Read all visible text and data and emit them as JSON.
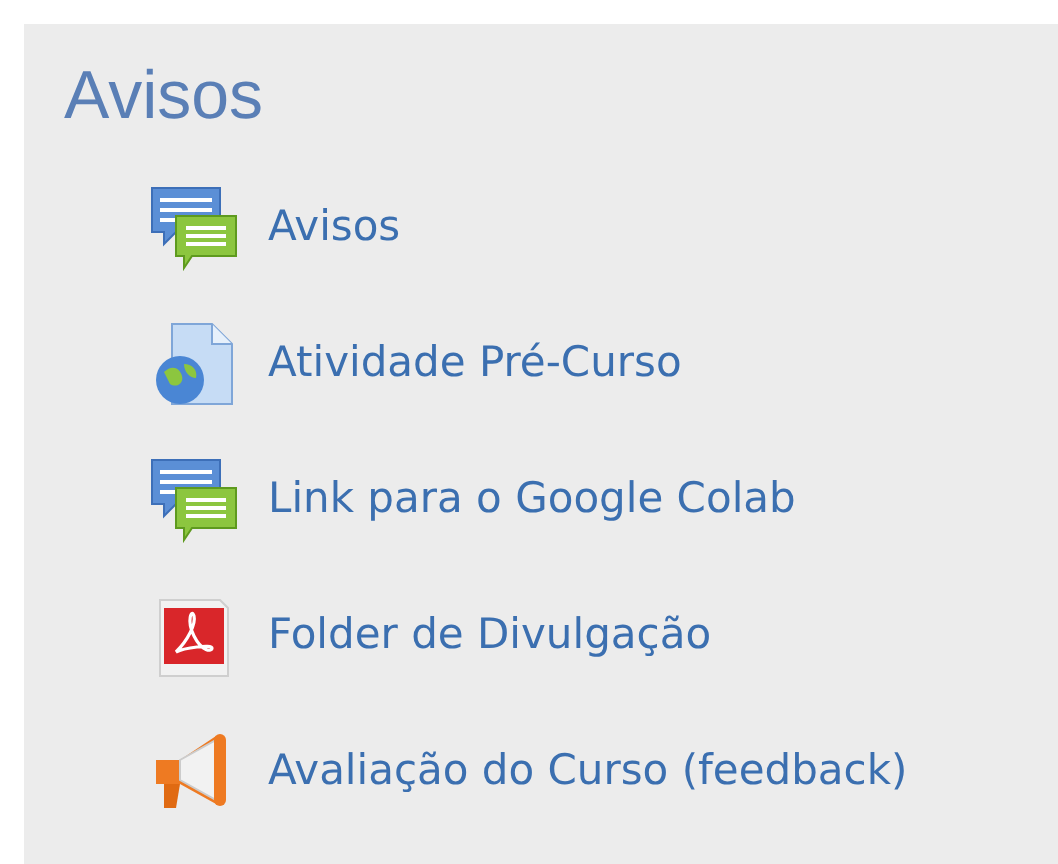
{
  "section": {
    "title": "Avisos"
  },
  "items": [
    {
      "kind": "forum",
      "label": "Avisos"
    },
    {
      "kind": "url",
      "label": "Atividade Pré-Curso"
    },
    {
      "kind": "forum",
      "label": "Link para o Google Colab"
    },
    {
      "kind": "pdf",
      "label": "Folder de Divulgação"
    },
    {
      "kind": "feedback",
      "label": "Avaliação do Curso (feedback)"
    }
  ]
}
